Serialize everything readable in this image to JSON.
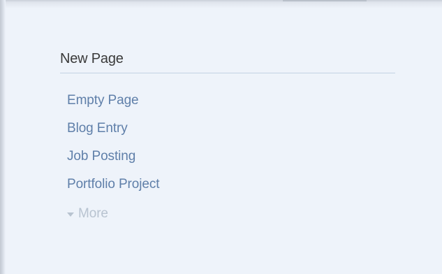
{
  "panel": {
    "title": "New Page",
    "items": [
      {
        "label": "Empty Page"
      },
      {
        "label": "Blog Entry"
      },
      {
        "label": "Job Posting"
      },
      {
        "label": "Portfolio Project"
      }
    ],
    "more_label": "More",
    "more_icon": "caret-down-icon"
  },
  "colors": {
    "background": "#eef3fa",
    "link": "#5f7fa9",
    "muted": "#b8c3d0",
    "title": "#3a3a3a",
    "divider": "#c3d2e3"
  }
}
